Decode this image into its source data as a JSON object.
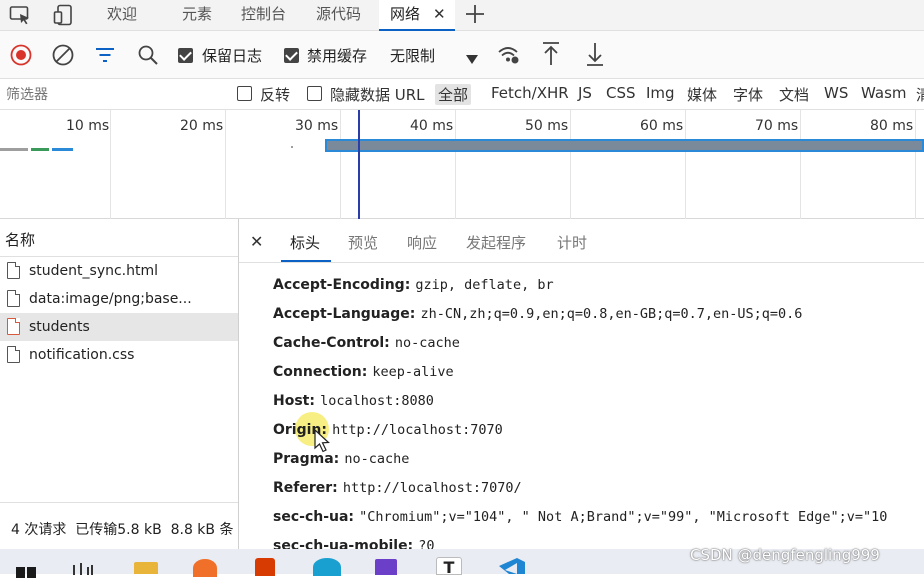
{
  "tabs": [
    {
      "label": "欢迎"
    },
    {
      "label": "元素"
    },
    {
      "label": "控制台"
    },
    {
      "label": "源代码"
    },
    {
      "label": "网络",
      "active": true
    }
  ],
  "toolbar": {
    "preserve_log": "保留日志",
    "disable_cache": "禁用缓存",
    "throttle": "无限制"
  },
  "filter": {
    "placeholder": "筛选器",
    "invert": "反转",
    "hide_data_urls": "隐藏数据 URL",
    "types": [
      "全部",
      "Fetch/XHR",
      "JS",
      "CSS",
      "Img",
      "媒体",
      "字体",
      "文档",
      "WS",
      "Wasm",
      "清"
    ]
  },
  "timeline": {
    "ticks": [
      "10 ms",
      "20 ms",
      "30 ms",
      "40 ms",
      "50 ms",
      "60 ms",
      "70 ms",
      "80 ms"
    ]
  },
  "requests": {
    "header": "名称",
    "items": [
      {
        "name": "student_sync.html",
        "selected": false,
        "icon": "document-icon"
      },
      {
        "name": "data:image/png;base...",
        "selected": false,
        "icon": "document-icon"
      },
      {
        "name": "students",
        "selected": true,
        "icon": "document-icon"
      },
      {
        "name": "notification.css",
        "selected": false,
        "icon": "document-icon"
      }
    ],
    "summary": "4 次请求  已传输5.8 kB  8.8 kB 条"
  },
  "detail": {
    "tabs": [
      "标头",
      "预览",
      "响应",
      "发起程序",
      "计时"
    ],
    "headers": [
      {
        "name": "Accept-Encoding:",
        "value": "gzip, deflate, br"
      },
      {
        "name": "Accept-Language:",
        "value": "zh-CN,zh;q=0.9,en;q=0.8,en-GB;q=0.7,en-US;q=0.6"
      },
      {
        "name": "Cache-Control:",
        "value": "no-cache"
      },
      {
        "name": "Connection:",
        "value": "keep-alive"
      },
      {
        "name": "Host:",
        "value": "localhost:8080"
      },
      {
        "name": "Origin:",
        "value": "http://localhost:7070"
      },
      {
        "name": "Pragma:",
        "value": "no-cache"
      },
      {
        "name": "Referer:",
        "value": "http://localhost:7070/"
      },
      {
        "name": "sec-ch-ua:",
        "value": "\"Chromium\";v=\"104\", \" Not A;Brand\";v=\"99\", \"Microsoft Edge\";v=\"10"
      },
      {
        "name": "sec-ch-ua-mobile:",
        "value": "?0"
      }
    ]
  },
  "watermark": "CSDN @dengfengling999",
  "colors": {
    "accent": "#0b62c4",
    "record": "#d9342b",
    "file_red": "#d65a3c"
  }
}
